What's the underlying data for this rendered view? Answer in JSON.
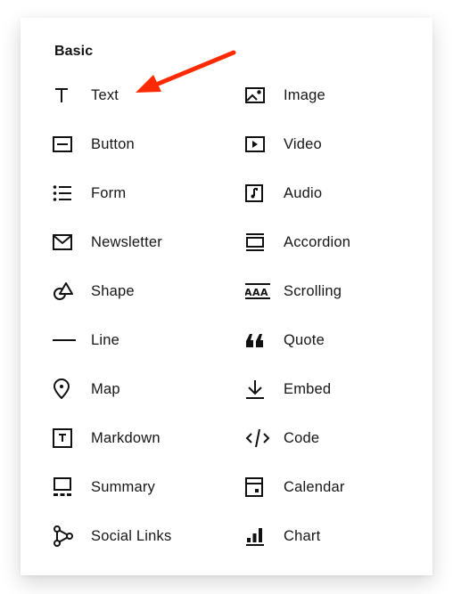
{
  "panel": {
    "section_title": "Basic",
    "columns": [
      [
        {
          "label": "Text",
          "icon": "text-icon"
        },
        {
          "label": "Button",
          "icon": "button-icon"
        },
        {
          "label": "Form",
          "icon": "form-list-icon"
        },
        {
          "label": "Newsletter",
          "icon": "envelope-icon"
        },
        {
          "label": "Shape",
          "icon": "shape-icon"
        },
        {
          "label": "Line",
          "icon": "line-icon"
        },
        {
          "label": "Map",
          "icon": "map-pin-icon"
        },
        {
          "label": "Markdown",
          "icon": "markdown-icon"
        },
        {
          "label": "Summary",
          "icon": "summary-icon"
        },
        {
          "label": "Social Links",
          "icon": "social-links-icon"
        }
      ],
      [
        {
          "label": "Image",
          "icon": "image-icon"
        },
        {
          "label": "Video",
          "icon": "video-icon"
        },
        {
          "label": "Audio",
          "icon": "audio-icon"
        },
        {
          "label": "Accordion",
          "icon": "accordion-icon"
        },
        {
          "label": "Scrolling",
          "icon": "scrolling-icon"
        },
        {
          "label": "Quote",
          "icon": "quote-icon"
        },
        {
          "label": "Embed",
          "icon": "embed-icon"
        },
        {
          "label": "Code",
          "icon": "code-icon"
        },
        {
          "label": "Calendar",
          "icon": "calendar-icon"
        },
        {
          "label": "Chart",
          "icon": "chart-icon"
        }
      ]
    ]
  },
  "annotation": {
    "type": "arrow",
    "points_to": "Text",
    "color": "#ff2a00"
  }
}
